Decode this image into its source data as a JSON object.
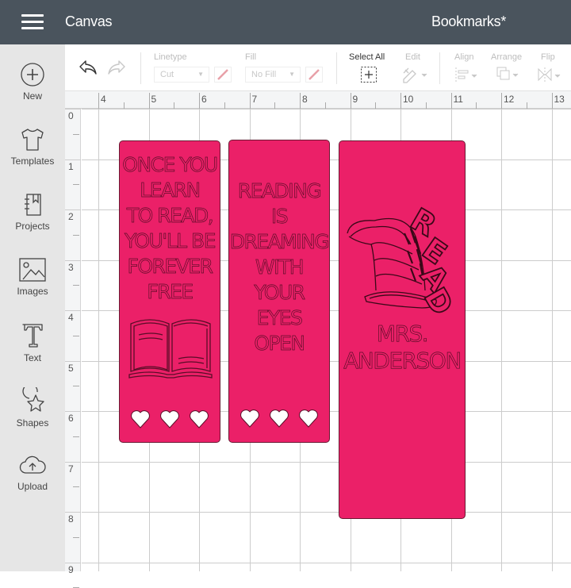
{
  "header": {
    "app_title": "Canvas",
    "document_title": "Bookmarks*"
  },
  "sidebar": {
    "items": [
      {
        "label": "New",
        "icon": "plus-circle-icon"
      },
      {
        "label": "Templates",
        "icon": "tshirt-icon"
      },
      {
        "label": "Projects",
        "icon": "notebook-icon"
      },
      {
        "label": "Images",
        "icon": "image-icon"
      },
      {
        "label": "Text",
        "icon": "text-t-icon"
      },
      {
        "label": "Shapes",
        "icon": "shapes-icon"
      },
      {
        "label": "Upload",
        "icon": "cloud-upload-icon"
      }
    ]
  },
  "toolbar": {
    "undo_icon": "undo-icon",
    "redo_icon": "redo-icon",
    "linetype_label": "Linetype",
    "linetype_value": "Cut",
    "fill_label": "Fill",
    "fill_value": "No Fill",
    "select_all_label": "Select All",
    "edit_label": "Edit",
    "align_label": "Align",
    "arrange_label": "Arrange",
    "flip_label": "Flip"
  },
  "ruler": {
    "horizontal": [
      "4",
      "5",
      "6",
      "7",
      "8",
      "9",
      "10",
      "11",
      "12",
      "13"
    ],
    "vertical": [
      "0",
      "1",
      "2",
      "3",
      "4",
      "5",
      "6",
      "7",
      "8",
      "9"
    ]
  },
  "canvas": {
    "bookmark_color": "#eb2068",
    "bookmarks": [
      {
        "lines": [
          "ONCE YOU",
          "LEARN",
          "TO READ,",
          "YOU'LL BE",
          "FOREVER",
          "FREE"
        ],
        "graphic": "open-book",
        "hearts": 3
      },
      {
        "lines": [
          "READING",
          "IS",
          "DREAMING",
          "WITH",
          "YOUR",
          "EYES",
          "OPEN"
        ],
        "hearts": 3
      },
      {
        "graphic": "cat-in-the-hat-hat",
        "graphic_text": "READ",
        "lines": [
          "MRS.",
          "ANDERSON"
        ]
      }
    ]
  }
}
